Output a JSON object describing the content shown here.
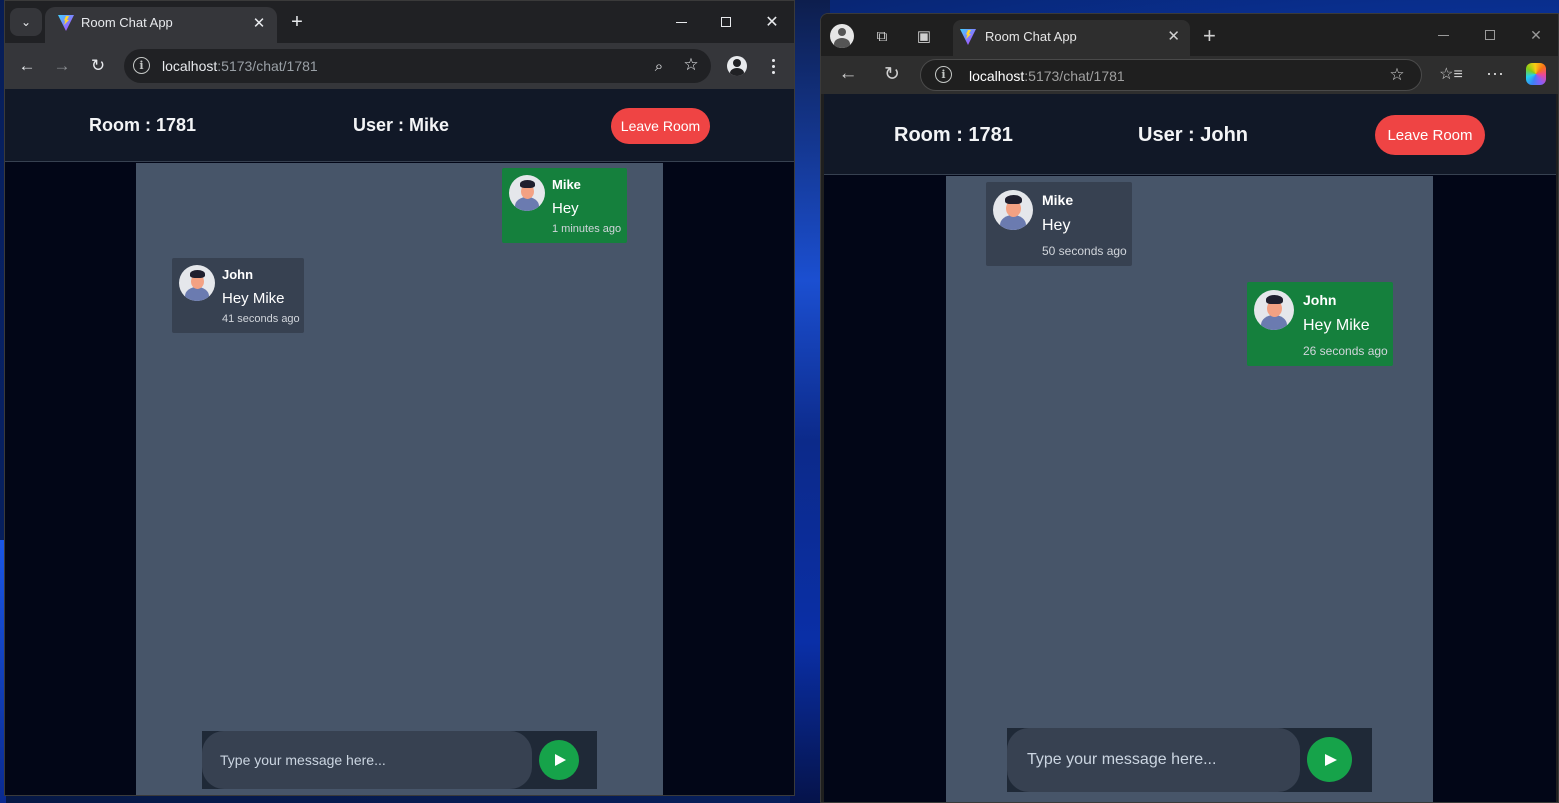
{
  "chrome": {
    "tab_title": "Room Chat App",
    "url_host": "localhost",
    "url_path": ":5173/chat/1781",
    "tab_search_icon": "chevron-down-icon",
    "new_tab_label": "+",
    "close_label": "✕"
  },
  "edge": {
    "tab_title": "Room Chat App",
    "url_host": "localhost",
    "url_path": ":5173/chat/1781",
    "new_tab_label": "+",
    "close_label": "✕"
  },
  "left_app": {
    "room_label": "Room : 1781",
    "user_label": "User : Mike",
    "leave_button": "Leave Room",
    "messages": [
      {
        "sender": "Mike",
        "text": "Hey",
        "time": "1 minutes ago",
        "own": true
      },
      {
        "sender": "John",
        "text": "Hey Mike",
        "time": "41 seconds ago",
        "own": false
      }
    ],
    "composer_placeholder": "Type your message here..."
  },
  "right_app": {
    "room_label": "Room : 1781",
    "user_label": "User : John",
    "leave_button": "Leave Room",
    "messages": [
      {
        "sender": "Mike",
        "text": "Hey",
        "time": "50 seconds ago",
        "own": false
      },
      {
        "sender": "John",
        "text": "Hey Mike",
        "time": "26 seconds ago",
        "own": true
      }
    ],
    "composer_placeholder": "Type your message here..."
  },
  "colors": {
    "own_bubble": "#15803d",
    "other_bubble": "#374151",
    "leave_button": "#ef4444",
    "send_button": "#16a34a",
    "chat_column": "#475569",
    "app_background": "#020617"
  }
}
